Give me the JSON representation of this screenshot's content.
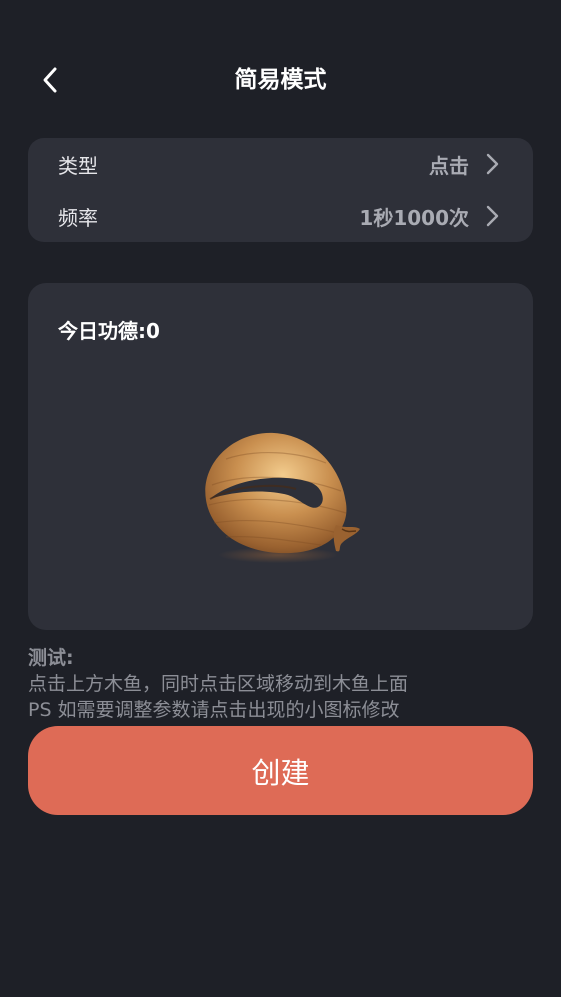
{
  "header": {
    "title": "简易模式",
    "back_icon": "chevron-left-icon"
  },
  "settings": {
    "type": {
      "label": "类型",
      "value": "点击"
    },
    "frequency": {
      "label": "频率",
      "value": "1秒1000次"
    },
    "chevron_icon": "chevron-right-icon"
  },
  "fish_panel": {
    "merit_label": "今日功德:",
    "merit_value": "0",
    "image": "wooden-fish-icon"
  },
  "instructions": {
    "title": "测试:",
    "line1": "点击上方木鱼，同时点击区域移动到木鱼上面",
    "line2": "PS 如需要调整参数请点击出现的小图标修改"
  },
  "create_button": {
    "label": "创建"
  },
  "colors": {
    "background": "#1e2027",
    "card": "#2e3039",
    "accent": "#de6b56",
    "muted_text": "#8c8e96"
  }
}
